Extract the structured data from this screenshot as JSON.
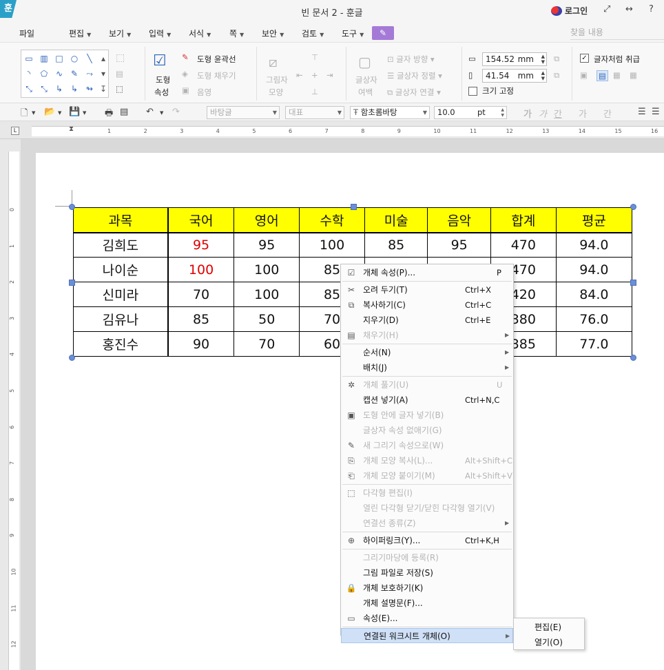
{
  "app": {
    "icon_glyph": "훈",
    "title": "빈 문서 2 - 훈글",
    "login": "로그인",
    "window_buttons": {
      "expand": "⤢",
      "split": "↔",
      "help": "?"
    }
  },
  "menubar": {
    "items": [
      "파일",
      "편집",
      "보기",
      "입력",
      "서식",
      "쪽",
      "보안",
      "검토",
      "도구"
    ],
    "find_placeholder": "찾을 내용"
  },
  "ribbon": {
    "shape_props": [
      "도형",
      "속성"
    ],
    "outline": "도형 윤곽선",
    "fill": "도형 채우기",
    "shadow": "음영",
    "picture_shape": [
      "그림자",
      "모양"
    ],
    "textbox_margin": [
      "글상자",
      "여백"
    ],
    "text_direction": "글자 방향",
    "textbox_align": "글상자 정렬",
    "textbox_link": "글상자 연결",
    "width_value": "154.52",
    "height_value": "41.54",
    "unit": "mm",
    "treat_as_char": "글자처럼 취급",
    "fix_size": "크기 고정"
  },
  "toolbar": {
    "style": "바탕글",
    "outline": "대표",
    "font": "함초롬바탕",
    "size": "10.0",
    "size_unit": "pt",
    "format_buttons": [
      "가",
      "가",
      "간",
      "가",
      "간"
    ]
  },
  "ruler": {
    "h_numbers": [
      "1",
      "2",
      "3",
      "4",
      "5",
      "6",
      "7",
      "8",
      "9",
      "10",
      "11",
      "12",
      "13",
      "14",
      "15",
      "16"
    ],
    "v_numbers": [
      "0",
      "1",
      "2",
      "3",
      "4",
      "5",
      "6",
      "7",
      "8",
      "9",
      "10",
      "11",
      "12"
    ]
  },
  "table": {
    "headers": [
      "과목",
      "국어",
      "영어",
      "수학",
      "미술",
      "음악",
      "합계",
      "평균"
    ],
    "rows": [
      [
        "김희도",
        "95",
        "95",
        "100",
        "85",
        "95",
        "470",
        "94.0"
      ],
      [
        "나이순",
        "100",
        "100",
        "85",
        "",
        "",
        "470",
        "94.0"
      ],
      [
        "신미라",
        "70",
        "100",
        "85",
        "",
        "",
        "420",
        "84.0"
      ],
      [
        "김유나",
        "85",
        "50",
        "70",
        "",
        "",
        "380",
        "76.0"
      ],
      [
        "홍진수",
        "90",
        "70",
        "60",
        "",
        "",
        "385",
        "77.0"
      ]
    ],
    "header_color": "#ffff00",
    "highlight_color": "#e00000"
  },
  "context_menu": {
    "items": [
      {
        "label": "개체 속성(P)...",
        "shortcut": "P",
        "disabled": false,
        "icon": "properties-icon"
      },
      {
        "sep": true
      },
      {
        "label": "오려 두기(T)",
        "shortcut": "Ctrl+X",
        "disabled": false,
        "icon": "scissors-icon"
      },
      {
        "label": "복사하기(C)",
        "shortcut": "Ctrl+C",
        "disabled": false,
        "icon": "copy-icon"
      },
      {
        "label": "지우기(D)",
        "shortcut": "Ctrl+E",
        "disabled": false,
        "icon": ""
      },
      {
        "label": "채우기(H)",
        "shortcut": "",
        "disabled": true,
        "icon": "fill-icon",
        "submenu": true
      },
      {
        "sep": true
      },
      {
        "label": "순서(N)",
        "shortcut": "",
        "disabled": false,
        "icon": "",
        "submenu": true
      },
      {
        "label": "배치(J)",
        "shortcut": "",
        "disabled": false,
        "icon": "",
        "submenu": true
      },
      {
        "sep": true
      },
      {
        "label": "개체 풀기(U)",
        "shortcut": "U",
        "disabled": true,
        "icon": "ungroup-icon"
      },
      {
        "label": "캡션 넣기(A)",
        "shortcut": "Ctrl+N,C",
        "disabled": false,
        "icon": ""
      },
      {
        "label": "도형 안에 글자 넣기(B)",
        "shortcut": "",
        "disabled": true,
        "icon": "text-in-shape-icon"
      },
      {
        "label": "글상자 속성 없애기(G)",
        "shortcut": "",
        "disabled": true,
        "icon": ""
      },
      {
        "label": "새 그리기 속성으로(W)",
        "shortcut": "",
        "disabled": true,
        "icon": "draw-props-icon"
      },
      {
        "label": "개체 모양 복사(L)...",
        "shortcut": "Alt+Shift+C",
        "disabled": true,
        "icon": "copy-shape-icon"
      },
      {
        "label": "개체 모양 붙이기(M)",
        "shortcut": "Alt+Shift+V",
        "disabled": true,
        "icon": "paste-shape-icon"
      },
      {
        "sep": true
      },
      {
        "label": "다각형 편집(I)",
        "shortcut": "",
        "disabled": true,
        "icon": "polygon-icon"
      },
      {
        "label": "열린 다각형 닫기/닫힌 다각형 열기(V)",
        "shortcut": "",
        "disabled": true,
        "icon": ""
      },
      {
        "label": "연결선 종류(Z)",
        "shortcut": "",
        "disabled": true,
        "icon": "",
        "submenu": true
      },
      {
        "sep": true
      },
      {
        "label": "하이퍼링크(Y)...",
        "shortcut": "Ctrl+K,H",
        "disabled": false,
        "icon": "hyperlink-icon"
      },
      {
        "sep": true
      },
      {
        "label": "그리기마당에 등록(R)",
        "shortcut": "",
        "disabled": true,
        "icon": ""
      },
      {
        "label": "그림 파일로 저장(S)",
        "shortcut": "",
        "disabled": false,
        "icon": ""
      },
      {
        "label": "개체 보호하기(K)",
        "shortcut": "",
        "disabled": false,
        "icon": "lock-icon"
      },
      {
        "label": "개체 설명문(F)...",
        "shortcut": "",
        "disabled": false,
        "icon": ""
      },
      {
        "label": "속성(E)...",
        "shortcut": "",
        "disabled": false,
        "icon": "ole-icon"
      },
      {
        "sep": true
      },
      {
        "label": "연결된 워크시트 개체(O)",
        "shortcut": "",
        "disabled": false,
        "icon": "",
        "submenu": true,
        "highlight": true
      }
    ]
  },
  "submenu": {
    "items": [
      "편집(E)",
      "열기(O)"
    ]
  }
}
